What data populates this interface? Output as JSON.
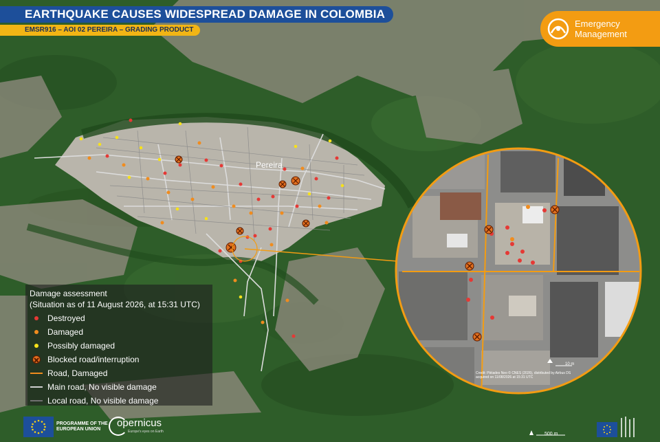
{
  "header": {
    "title": "EARTHQUAKE CAUSES WIDESPREAD DAMAGE IN COLOMBIA",
    "subtitle": "EMSR916 – AOI 02 PEREIRA – GRADING PRODUCT"
  },
  "badge": {
    "line1": "Emergency",
    "line2": "Management"
  },
  "map": {
    "city_label": "Pereira",
    "scale_label": "500 m",
    "inset_scale_label": "10 m",
    "inset_credit_1": "Credit: Pléiades Neo © CNES (2026), distributed by Airbus DS",
    "inset_credit_2": "acquired on 11/08/2026 at 15:31 UTC"
  },
  "legend": {
    "title": "Damage assessment",
    "subtitle": "(Situation as of 11 August 2026, at 15:31 UTC)",
    "items": [
      {
        "label": "Destroyed",
        "color": "#e53935",
        "symbol": "dot"
      },
      {
        "label": "Damaged",
        "color": "#f08c1e",
        "symbol": "dot"
      },
      {
        "label": "Possibly damaged",
        "color": "#f7e11a",
        "symbol": "dot"
      },
      {
        "label": "Blocked road/interruption",
        "color": "#e1701f",
        "symbol": "blocked"
      },
      {
        "label": "Road, Damaged",
        "color": "#f08c1e",
        "symbol": "line"
      },
      {
        "label": "Main road, No visible damage",
        "color": "#d0d0d0",
        "symbol": "line"
      },
      {
        "label": "Local road, No visible damage",
        "color": "#707070",
        "symbol": "line"
      }
    ]
  },
  "footer": {
    "eu_line1": "PROGRAMME OF THE",
    "eu_line2": "EUROPEAN UNION",
    "copernicus": "opernicus",
    "copernicus_tag": "Europe's eyes on Earth"
  },
  "colors": {
    "title_bg": "#1d4f9a",
    "subtitle_bg": "#f2b515",
    "badge_bg": "#f39c12",
    "inset_border": "#f39c12"
  }
}
